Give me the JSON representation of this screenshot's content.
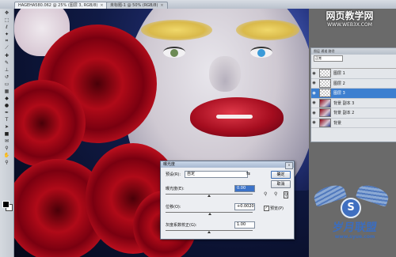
{
  "tabs": [
    {
      "label": "HAGEHA580.062 @ 25% (图层 3, RGB/8)",
      "close": "×"
    },
    {
      "label": "未标题-1 @ 50% (RGB/8)",
      "close": "×"
    }
  ],
  "layers_panel": {
    "tabs": "图层 通道 路径",
    "blend_mode": "正常",
    "layers": [
      {
        "name": "图层 1"
      },
      {
        "name": "图层 2"
      },
      {
        "name": "图层 3"
      },
      {
        "name": "背景 副本 3"
      },
      {
        "name": "背景 副本 2"
      },
      {
        "name": "背景"
      }
    ]
  },
  "dialog": {
    "title": "曝光度",
    "preset_label": "预设(R):",
    "preset_value": "自定",
    "exposure_label": "曝光度(E):",
    "exposure_value": "0.00",
    "offset_label": "位移(O):",
    "offset_value": "+0.0020",
    "gamma_label": "灰度系数校正(G):",
    "gamma_value": "1.00",
    "ok": "确定",
    "cancel": "取消",
    "preview": "预览(P)",
    "close": "×"
  },
  "watermark_top": {
    "title": "网页教学网",
    "url": "WWW.WEB3X.COM"
  },
  "watermark_bottom": {
    "letter": "S",
    "title": "岁月联盟",
    "url": "www.syue.com"
  },
  "colors": {
    "accent": "#3d7fd0",
    "lips": "#a50d1f",
    "rose": "#b00a18"
  }
}
